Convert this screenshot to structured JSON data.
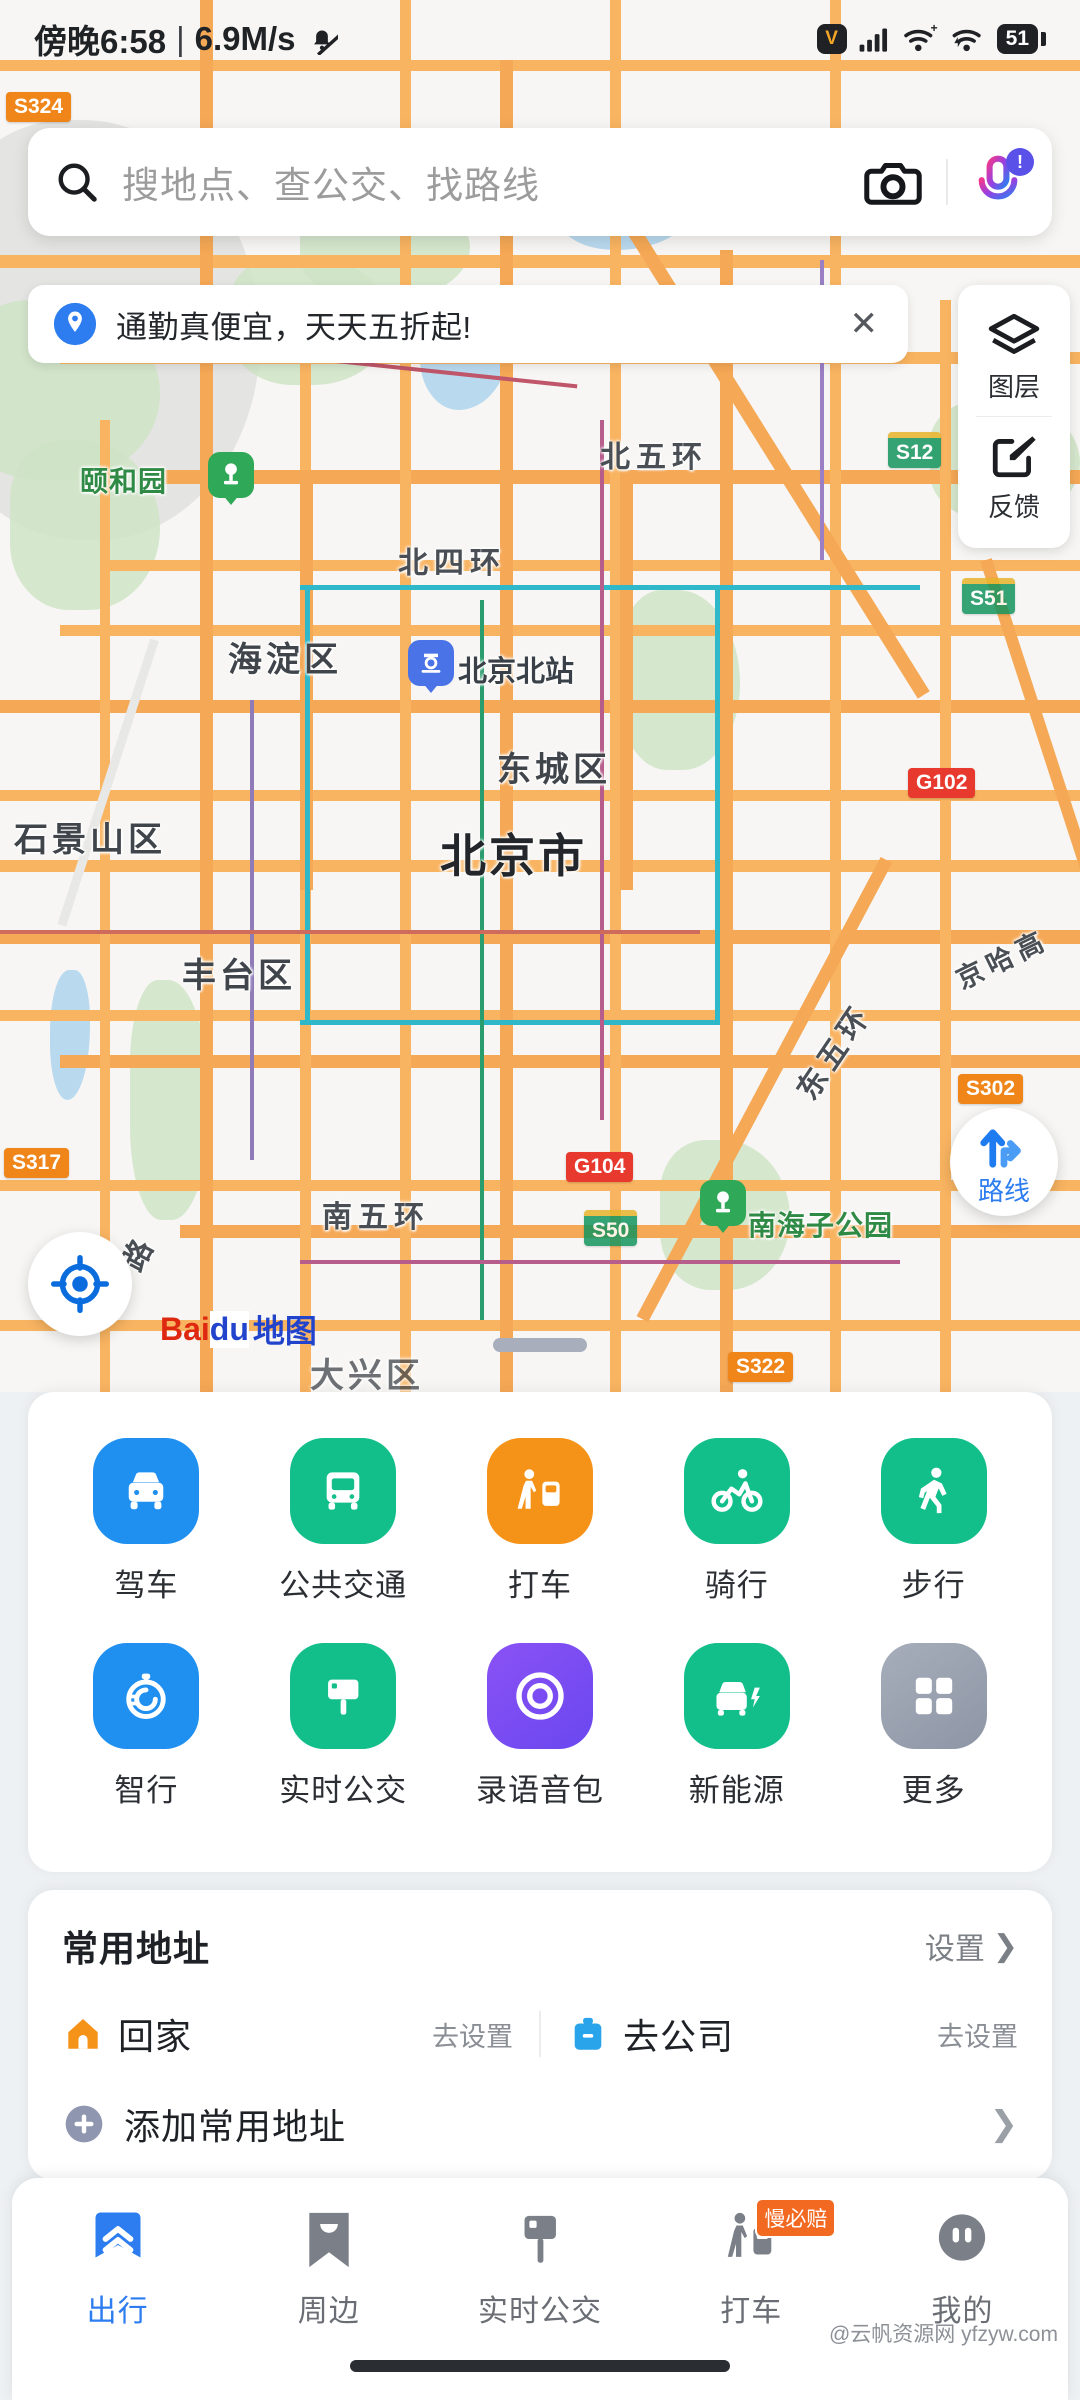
{
  "status_bar": {
    "time": "傍晚6:58",
    "separator": "|",
    "network_speed": "6.9M/s",
    "mute_icon": "bell-muted-icon",
    "volte_label": "V",
    "battery": "51",
    "icons": [
      "volte-icon",
      "signal-icon",
      "wifi-plus-icon",
      "wifi-icon",
      "battery-icon"
    ]
  },
  "search": {
    "placeholder": "搜地点、查公交、找路线",
    "search_icon": "search-icon",
    "camera_icon": "camera-icon",
    "mic_icon": "microphone-icon",
    "mic_badge": "!"
  },
  "promo": {
    "text": "通勤真便宜，天天五折起!",
    "pin_icon": "location-pin-icon",
    "close_label": "✕"
  },
  "map_tools": [
    {
      "label": "图层",
      "icon": "layers-icon"
    },
    {
      "label": "反馈",
      "icon": "edit-feedback-icon"
    }
  ],
  "map": {
    "route_button": {
      "label": "路线",
      "icon": "route-arrow-icon"
    },
    "locate_button": {
      "icon": "locate-crosshair-icon"
    },
    "logo": {
      "part1": "Bai",
      "part2": "du",
      "part3": "地图"
    },
    "labels": [
      {
        "text": "颐和园",
        "type": "poi"
      },
      {
        "text": "北五环",
        "type": "ring"
      },
      {
        "text": "北四环",
        "type": "ring"
      },
      {
        "text": "海淀区",
        "type": "district"
      },
      {
        "text": "东城区",
        "type": "district"
      },
      {
        "text": "石景山区",
        "type": "district"
      },
      {
        "text": "北京市",
        "type": "city"
      },
      {
        "text": "丰台区",
        "type": "district"
      },
      {
        "text": "南五环",
        "type": "ring"
      },
      {
        "text": "东五环",
        "type": "ring"
      },
      {
        "text": "京哈高",
        "type": "ring"
      },
      {
        "text": "南海子公园",
        "type": "poi"
      },
      {
        "text": "北京北站",
        "type": "station"
      },
      {
        "text": "大兴区",
        "type": "district"
      },
      {
        "text": "路",
        "type": "road"
      }
    ],
    "shields": [
      {
        "code": "S324",
        "color": "orange"
      },
      {
        "code": "S12",
        "color": "green"
      },
      {
        "code": "S51",
        "color": "green"
      },
      {
        "code": "G102",
        "color": "red"
      },
      {
        "code": "S302",
        "color": "orange"
      },
      {
        "code": "S317",
        "color": "orange"
      },
      {
        "code": "G104",
        "color": "red"
      },
      {
        "code": "S50",
        "color": "green"
      },
      {
        "code": "S322",
        "color": "orange"
      }
    ]
  },
  "modes": {
    "row1": [
      {
        "label": "驾车",
        "icon": "car-icon",
        "color": "#1f8ff0"
      },
      {
        "label": "公共交通",
        "icon": "bus-icon",
        "color": "#12bf8a"
      },
      {
        "label": "打车",
        "icon": "hail-taxi-icon",
        "color": "#f59218"
      },
      {
        "label": "骑行",
        "icon": "bicycle-icon",
        "color": "#12bf8a"
      },
      {
        "label": "步行",
        "icon": "walk-icon",
        "color": "#12bf8a"
      }
    ],
    "row2": [
      {
        "label": "智行",
        "icon": "stopwatch-icon",
        "color": "#1f8ff0"
      },
      {
        "label": "实时公交",
        "icon": "bus-stop-sign-icon",
        "color": "#12bf8a"
      },
      {
        "label": "录语音包",
        "icon": "record-ring-icon",
        "color": "#7b4df0"
      },
      {
        "label": "新能源",
        "icon": "ev-charge-icon",
        "color": "#12bf8a"
      },
      {
        "label": "更多",
        "icon": "grid-more-icon",
        "color": "#9aa3b2"
      }
    ]
  },
  "addresses": {
    "title": "常用地址",
    "settings_link": "设置",
    "settings_chevron": "❯",
    "home": {
      "label": "回家",
      "action": "去设置",
      "icon": "home-icon"
    },
    "work": {
      "label": "去公司",
      "action": "去设置",
      "icon": "briefcase-icon"
    },
    "add": {
      "label": "添加常用地址",
      "icon": "plus-circle-icon",
      "chevron": "❯"
    }
  },
  "bottom_nav": [
    {
      "label": "出行",
      "icon": "chevrons-up-icon",
      "active": true,
      "badge": ""
    },
    {
      "label": "周边",
      "icon": "bookmark-icon",
      "active": false,
      "badge": ""
    },
    {
      "label": "实时公交",
      "icon": "bus-stop-icon",
      "active": false,
      "badge": ""
    },
    {
      "label": "打车",
      "icon": "hail-taxi-icon",
      "active": false,
      "badge": "慢必赔"
    },
    {
      "label": "我的",
      "icon": "profile-icon",
      "active": false,
      "badge": ""
    }
  ],
  "watermark": "@云帆资源网 yfzyw.com",
  "colors": {
    "accent_blue": "#2d7df0",
    "green": "#12bf8a",
    "orange": "#f59218",
    "purple": "#7b4df0"
  }
}
